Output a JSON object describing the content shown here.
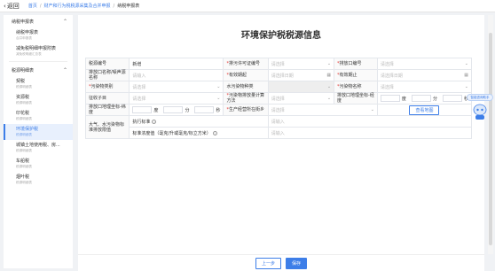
{
  "topbar": {
    "back_label": "返回",
    "crumbs": [
      "首页",
      "财产和行为税税源采集及合并申报",
      "纳税申报表"
    ]
  },
  "sidebar": {
    "groups": [
      {
        "title": "纳税申报表",
        "items": [
          {
            "title": "纳税申报表",
            "sub": "合并申报表"
          },
          {
            "title": "减免税明细申报附表",
            "sub": "减免税明细汇总表"
          }
        ]
      },
      {
        "title": "税源明细表",
        "items": [
          {
            "title": "契税",
            "sub": "税源明细表"
          },
          {
            "title": "资源税",
            "sub": "税源明细表"
          },
          {
            "title": "印花税",
            "sub": "税源明细表"
          },
          {
            "title": "环境保护税",
            "sub": "税源明细表"
          },
          {
            "title": "城镇土地使用税、房...",
            "sub": "税源明细表"
          },
          {
            "title": "车船税",
            "sub": "税源明细表"
          },
          {
            "title": "烟叶税",
            "sub": "税源明细表"
          }
        ]
      }
    ]
  },
  "main": {
    "title": "环境保护税税源信息",
    "form": {
      "r1": {
        "l1": "税源编号",
        "v1": "新增",
        "l2": "排污许可证编号",
        "p2": "请选择",
        "l3": "排放口编号",
        "p3": "请选择"
      },
      "r2": {
        "l1": "排放口名称/噪声源名称",
        "p1": "请输入",
        "l2": "有效期起",
        "p2": "请选择日期",
        "l3": "有效期止",
        "p3": "请选择日期"
      },
      "r3": {
        "l1": "污染物类别",
        "p1": "请选择",
        "l2": "水污染物种类",
        "l3": "污染物名称",
        "p3": "请选择"
      },
      "r4": {
        "l1": "征收子目",
        "p1": "请选择",
        "l2": "污染物排放量计算方法",
        "p2": "请选择",
        "l3": "排放口地理坐标-经度",
        "u1": "度",
        "u2": "分",
        "u3": "秒"
      },
      "r5": {
        "l1": "排放口地理坐标-纬度",
        "u1": "度",
        "u2": "分",
        "u3": "秒",
        "l2": "生产经营所在街乡",
        "p2": "请选择",
        "btn": "查看地图"
      },
      "r6": {
        "l1": "大气、水污染物标准排放限值",
        "l2": "执行标准",
        "p2": "请输入"
      },
      "r7": {
        "l2": "标准浓度值（毫克/升或毫克/标立方米）",
        "p2": "请输入"
      }
    }
  },
  "footer": {
    "prev_label": "上一步",
    "save_label": "保存"
  },
  "assistant": {
    "bubble_label": "智能咨询助手"
  },
  "colors": {
    "accent": "#3d7ee8",
    "required": "#e53935"
  }
}
